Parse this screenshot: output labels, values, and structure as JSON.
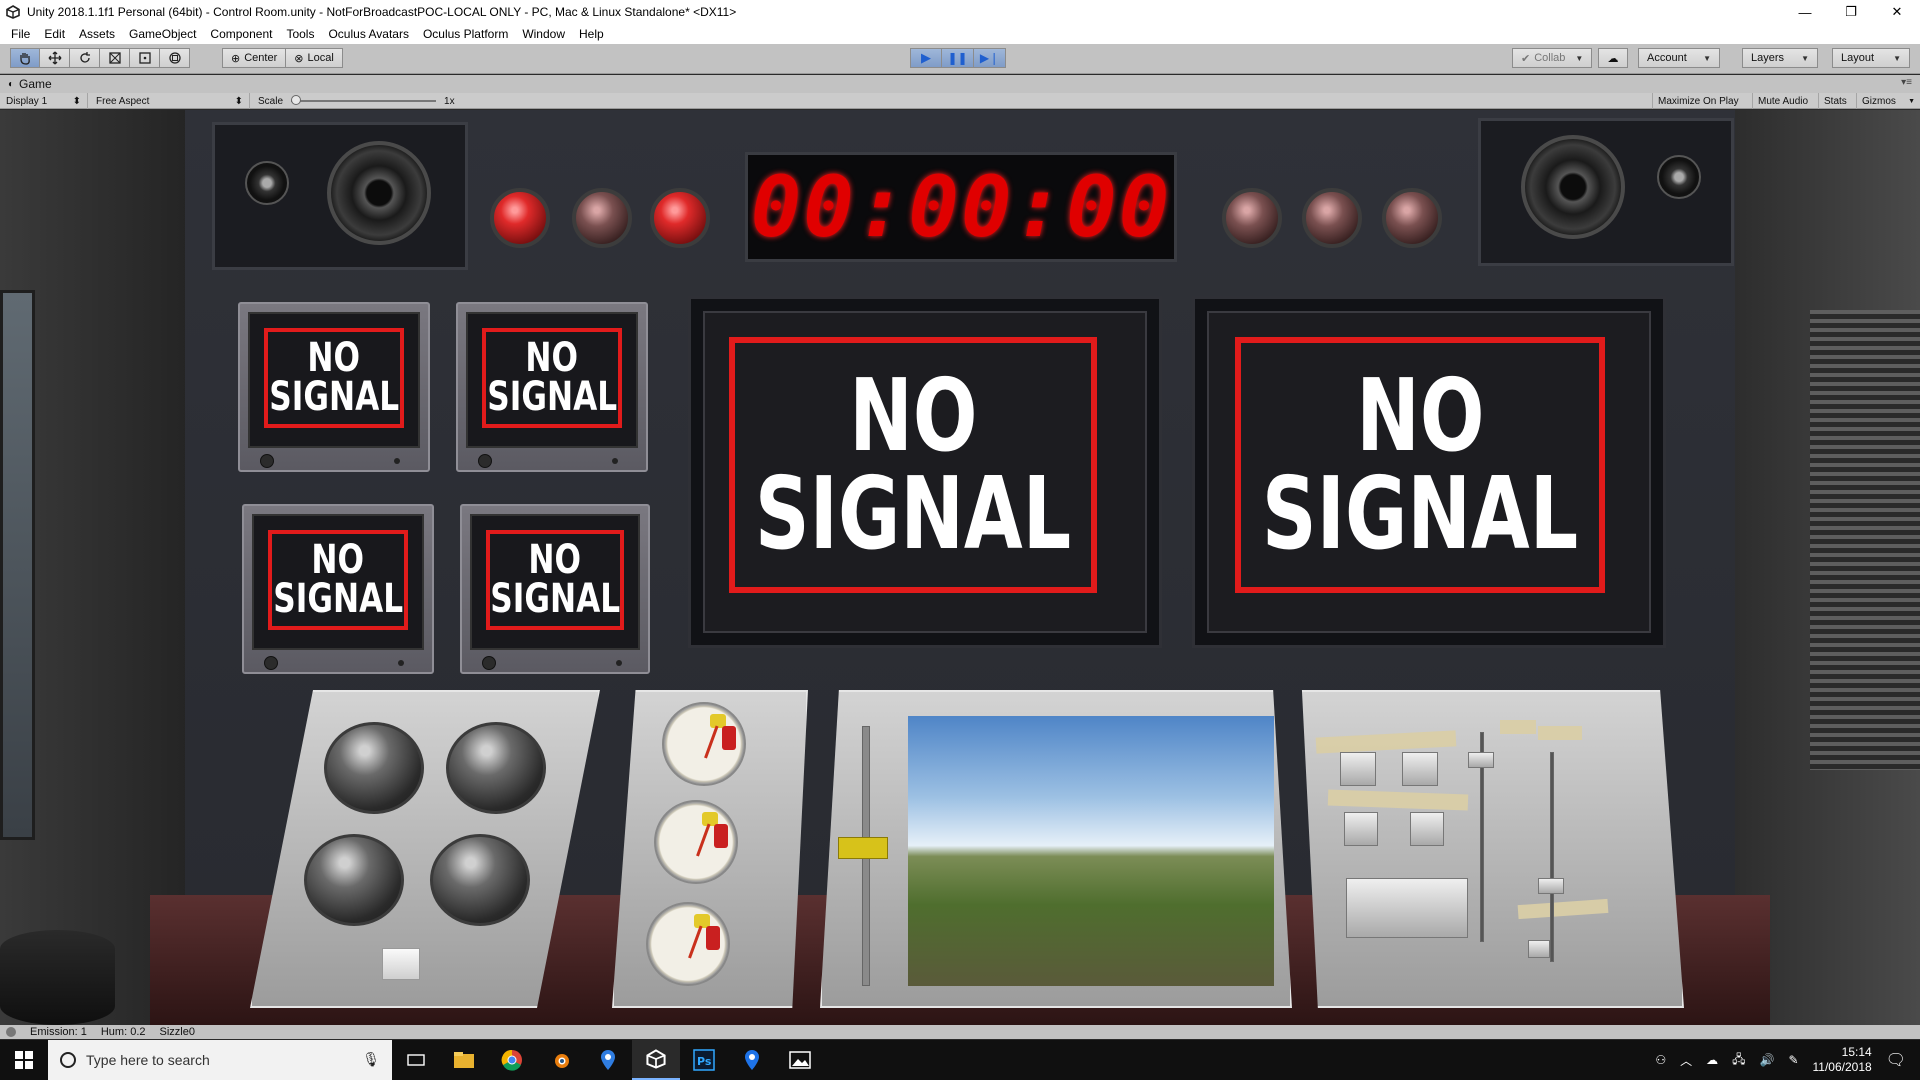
{
  "window": {
    "title": "Unity 2018.1.1f1 Personal (64bit) - Control Room.unity - NotForBroadcastPOC-LOCAL ONLY - PC, Mac & Linux Standalone* <DX11>",
    "minimize": "—",
    "maximize": "❐",
    "close": "✕"
  },
  "menu": [
    "File",
    "Edit",
    "Assets",
    "GameObject",
    "Component",
    "Tools",
    "Oculus Avatars",
    "Oculus Platform",
    "Window",
    "Help"
  ],
  "toolbar": {
    "tools": [
      "hand-icon",
      "move-icon",
      "rotate-icon",
      "scale-icon",
      "rect-icon",
      "transform-icon"
    ],
    "pivot": "Center",
    "space": "Local",
    "collab": "Collab",
    "account": "Account",
    "layers": "Layers",
    "layout": "Layout"
  },
  "game_tab": {
    "label": "Game",
    "display": "Display 1",
    "aspect": "Free Aspect",
    "scale_label": "Scale",
    "scale_value": "1x",
    "scale_fraction": 0,
    "maximize": "Maximize On Play",
    "mute": "Mute Audio",
    "stats": "Stats",
    "gizmos": "Gizmos"
  },
  "scene": {
    "timer": "00:00:00",
    "no_signal_line1": "NO",
    "no_signal_line2": "SIGNAL",
    "lamps_left": [
      "on",
      "off",
      "on"
    ],
    "lamps_right": [
      "off",
      "off",
      "off"
    ],
    "accent_red": "#e11b1b",
    "slider_fraction": 0.47
  },
  "status": {
    "emission": "Emission: 1",
    "hum": "Hum: 0.2",
    "sizzle": "Sizzle0"
  },
  "taskbar": {
    "search_placeholder": "Type here to search",
    "time": "15:14",
    "date": "11/06/2018",
    "apps": [
      "task-view-icon",
      "file-explorer-icon",
      "chrome-icon",
      "blender-icon",
      "maps-icon",
      "unity-icon",
      "photoshop-icon",
      "location-icon",
      "photos-icon"
    ]
  }
}
